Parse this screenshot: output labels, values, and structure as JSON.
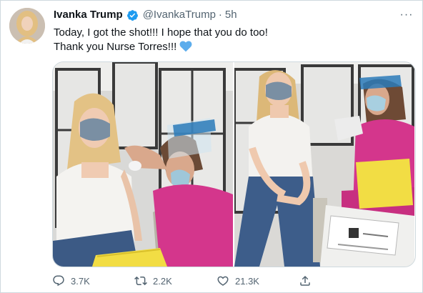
{
  "tweet": {
    "author_name": "Ivanka Trump",
    "handle": "@IvankaTrump",
    "separator": "·",
    "time": "5h",
    "text_line1": "Today, I got the shot!!! I hope that you do too!",
    "text_line2": "Thank you Nurse Torres!!!",
    "more_glyph": "···"
  },
  "actions": {
    "reply_count": "3.7K",
    "retweet_count": "2.2K",
    "like_count": "21.3K"
  },
  "icons": {
    "verified": "verified-badge-icon",
    "heart_emoji": "blue-heart-icon",
    "reply": "reply-icon",
    "retweet": "retweet-icon",
    "like": "like-icon",
    "share": "share-icon",
    "more": "more-options-icon"
  },
  "colors": {
    "verified_blue": "#1d9bf0",
    "secondary_text": "#536471",
    "scrubs_pink": "#d4368c"
  }
}
